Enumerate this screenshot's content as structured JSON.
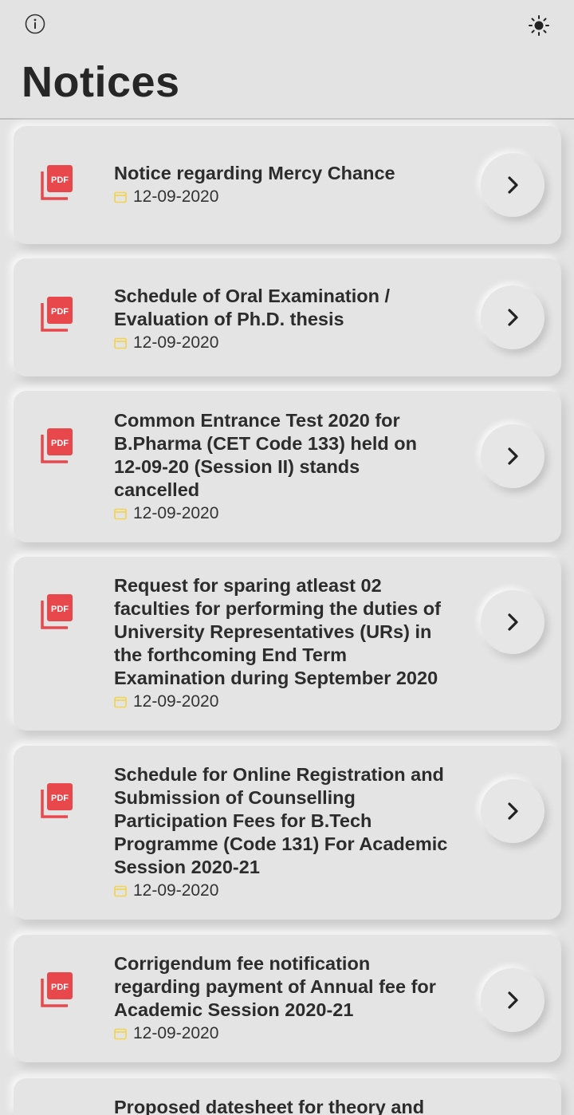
{
  "header": {
    "title": "Notices",
    "info_icon": "info-icon",
    "theme_icon": "sun-icon"
  },
  "colors": {
    "background": "#e3e3e3",
    "pdf_red": "#e8474c",
    "calendar_yellow": "#f2d34a",
    "text": "#2c2c2c"
  },
  "notices": [
    {
      "title": "Notice regarding Mercy Chance",
      "date": "12-09-2020"
    },
    {
      "title": "Schedule of Oral Examination / Evaluation of Ph.D. thesis",
      "date": "12-09-2020"
    },
    {
      "title": "Common Entrance Test 2020 for B.Pharma (CET Code 133) held on 12-09-20 (Session II) stands cancelled",
      "date": "12-09-2020"
    },
    {
      "title": "Request for sparing atleast 02 faculties for performing the duties of University Representatives (URs) in the forthcoming End Term Examination during September 2020",
      "date": "12-09-2020"
    },
    {
      "title": "Schedule for Online Registration and Submission of Counselling Participation Fees for B.Tech Programme (Code 131) For Academic Session 2020-21",
      "date": "12-09-2020"
    },
    {
      "title": "Corrigendum fee notification regarding payment of Annual fee for Academic Session 2020-21",
      "date": "12-09-2020"
    },
    {
      "title": "Proposed datesheet for theory and",
      "date": ""
    }
  ]
}
